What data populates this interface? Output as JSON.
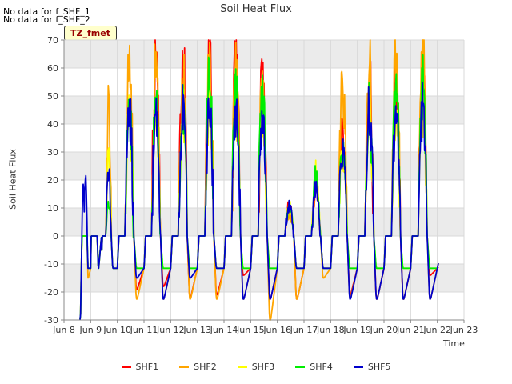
{
  "header": {
    "nodata_1": "No data for f_SHF_1",
    "nodata_2": "No data for f_SHF_2",
    "badge": "TZ_fmet"
  },
  "colors": {
    "SHF1": "#ff0000",
    "SHF2": "#ffa500",
    "SHF3": "#ffff00",
    "SHF4": "#00ee00",
    "SHF5": "#0000cc",
    "plot_band": "#ebebeb",
    "grid": "#d8d8d8"
  },
  "chart_data": {
    "type": "line",
    "title": "Soil Heat Flux",
    "xlabel": "Time",
    "ylabel": "Soil Heat Flux",
    "xlim": [
      8,
      23
    ],
    "ylim": [
      -30,
      70
    ],
    "grid": true,
    "legend_position": "bottom",
    "x_tick_values": [
      8,
      9,
      10,
      11,
      12,
      13,
      14,
      15,
      16,
      17,
      18,
      19,
      20,
      21,
      22,
      23
    ],
    "x_tick_labels": [
      "Jun 8",
      "Jun 9",
      "Jun 10",
      "Jun 11",
      "Jun 12",
      "Jun 13",
      "Jun 14",
      "Jun 15",
      "Jun 16",
      "Jun 17",
      "Jun 18",
      "Jun 19",
      "Jun 20",
      "Jun 21",
      "Jun 22",
      "Jun 23"
    ],
    "y_ticks": [
      -30,
      -20,
      -10,
      0,
      10,
      20,
      30,
      40,
      50,
      60,
      70
    ],
    "days": [
      {
        "start": 8.65,
        "pre": -11.5,
        "night": -11.5,
        "peak": 0,
        "burst": 18.5
      },
      {
        "start": 9.0,
        "pre": -0.5,
        "night": -11.5,
        "peak": 0
      },
      {
        "start": 9.4,
        "pre": -11.5,
        "night": -11.5,
        "peak": 22
      },
      {
        "start": 10.0,
        "pre": -11.5,
        "night": -22.5,
        "peak": 45
      },
      {
        "start": 11.0,
        "pre": -11.5,
        "night": -22.5,
        "peak": 45
      },
      {
        "start": 12.0,
        "pre": -11.5,
        "night": -22.5,
        "peak": 45
      },
      {
        "start": 13.0,
        "pre": -11.5,
        "night": -22.5,
        "peak": 45
      },
      {
        "start": 14.0,
        "pre": -11.5,
        "night": -22.5,
        "peak": 45
      },
      {
        "start": 15.0,
        "pre": -11.5,
        "night": -22.5,
        "peak": 45
      },
      {
        "start": 16.0,
        "pre": -11.5,
        "night": -11.5,
        "peak": 11
      },
      {
        "start": 17.0,
        "pre": -11.5,
        "night": -11.5,
        "peak": 18
      },
      {
        "start": 18.0,
        "pre": -11.5,
        "night": -22.5,
        "peak": 30
      },
      {
        "start": 19.0,
        "pre": -11.5,
        "night": -22.5,
        "peak": 45
      },
      {
        "start": 20.0,
        "pre": -11.5,
        "night": -22.5,
        "peak": 45
      },
      {
        "start": 21.0,
        "pre": -11.5,
        "night": -22.5,
        "peak": 45
      }
    ],
    "series": [
      {
        "name": "SHF1",
        "color": "#ff0000",
        "x_start": 10.6,
        "x_end": 22.05,
        "peaks": [
          0,
          0,
          0,
          67,
          65,
          67,
          67,
          67,
          59,
          11,
          18,
          36,
          56,
          56,
          56
        ],
        "troughs": [
          -11.5,
          -8,
          -11.5,
          -19,
          -18,
          -22,
          -21,
          -14,
          -22.5,
          -22.5,
          -11.5,
          -21,
          -22.5,
          -22.5,
          -14
        ]
      },
      {
        "name": "SHF2",
        "color": "#ffa500",
        "x_start": 8.6,
        "x_end": 22.05,
        "peaks": [
          0,
          0,
          46,
          61,
          63,
          59,
          59,
          61,
          56,
          8,
          20,
          53,
          64,
          69,
          65
        ],
        "troughs": [
          -15,
          -11.5,
          -11.5,
          -22.5,
          -22.5,
          -22.5,
          -22.5,
          -22.5,
          -30,
          -22.5,
          -15,
          -22,
          -22.5,
          -22.5,
          -22.5
        ]
      },
      {
        "name": "SHF3",
        "color": "#ffff00",
        "x_start": 8.6,
        "x_end": 22.05,
        "peaks": [
          0,
          0,
          28,
          45,
          45,
          45,
          45,
          45,
          45,
          11,
          23,
          29,
          45,
          45,
          45
        ],
        "troughs": [
          -11.5,
          -11.5,
          -11.5,
          -11.5,
          -11.5,
          -11.5,
          -11.5,
          -11.5,
          -11.5,
          -11.5,
          -11.5,
          -11.5,
          -11.5,
          -11.5,
          -11.5
        ]
      },
      {
        "name": "SHF4",
        "color": "#00ee00",
        "x_start": 8.6,
        "x_end": 22.05,
        "peaks": [
          0,
          0,
          11,
          45,
          49,
          45,
          56,
          56,
          56,
          11,
          22,
          30,
          45,
          56,
          53
        ],
        "troughs": [
          -11.5,
          -11.5,
          -11.5,
          -11.5,
          -11.5,
          -11.5,
          -11.5,
          -11.5,
          -11.5,
          -11.5,
          -11.5,
          -11.5,
          -11.5,
          -11.5,
          -11.5
        ]
      },
      {
        "name": "SHF5",
        "color": "#0000cc",
        "x_start": 8.6,
        "x_end": 22.05,
        "peaks": [
          18.5,
          0,
          22,
          45,
          45,
          45,
          45,
          45,
          45,
          11,
          18,
          30,
          45,
          45,
          45
        ],
        "troughs": [
          -11.5,
          -11.5,
          -11.5,
          -15,
          -22.5,
          -15,
          -11.5,
          -22.5,
          -22.5,
          -11.5,
          -11.5,
          -22.5,
          -22.5,
          -22.5,
          -22.5
        ]
      }
    ]
  }
}
